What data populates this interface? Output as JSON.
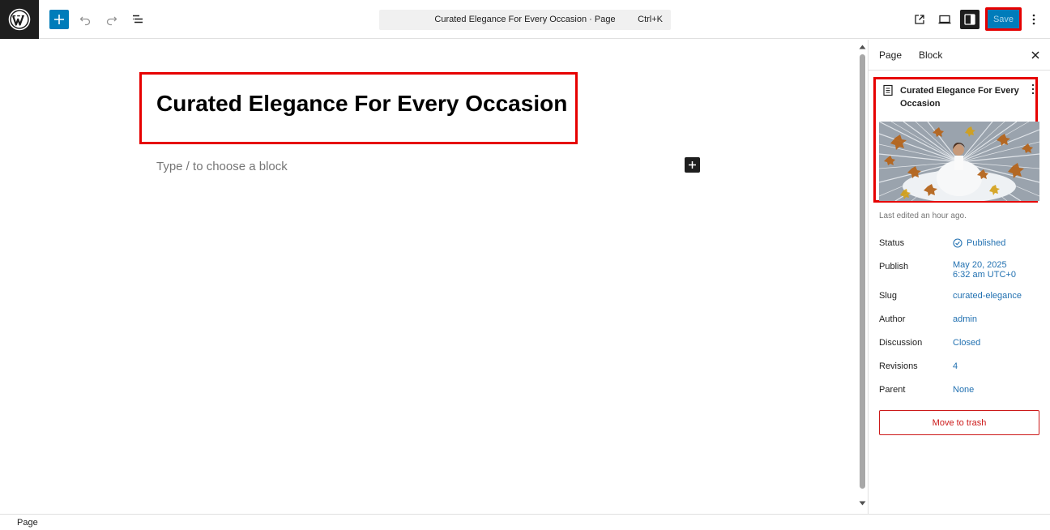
{
  "topbar": {
    "command_title": "Curated Elegance For Every Occasion · Page",
    "command_shortcut": "Ctrl+K",
    "save_label": "Save"
  },
  "canvas": {
    "page_title": "Curated Elegance For Every Occasion",
    "block_placeholder": "Type / to choose a block"
  },
  "sidebar": {
    "tabs": [
      "Page",
      "Block"
    ],
    "summary_title": "Curated Elegance For Every Occasion",
    "last_edited": "Last edited an hour ago.",
    "meta": [
      {
        "label": "Status",
        "value": "Published"
      },
      {
        "label": "Publish",
        "value": "May 20, 2025",
        "value2": "6:32 am UTC+0"
      },
      {
        "label": "Slug",
        "value": "curated-elegance"
      },
      {
        "label": "Author",
        "value": "admin"
      },
      {
        "label": "Discussion",
        "value": "Closed"
      },
      {
        "label": "Revisions",
        "value": "4"
      },
      {
        "label": "Parent",
        "value": "None"
      }
    ],
    "trash_label": "Move to trash"
  },
  "footer": {
    "breadcrumb": "Page"
  },
  "colors": {
    "accent": "#007cba",
    "link": "#2271b1",
    "highlight": "#e60000",
    "danger": "#cc1818"
  },
  "icons": [
    "wordpress-logo-icon",
    "plus-icon",
    "undo-icon",
    "redo-icon",
    "list-view-icon",
    "external-link-icon",
    "desktop-preview-icon",
    "sidebar-toggle-icon",
    "more-vertical-icon",
    "close-icon",
    "page-icon",
    "check-circle-icon"
  ]
}
